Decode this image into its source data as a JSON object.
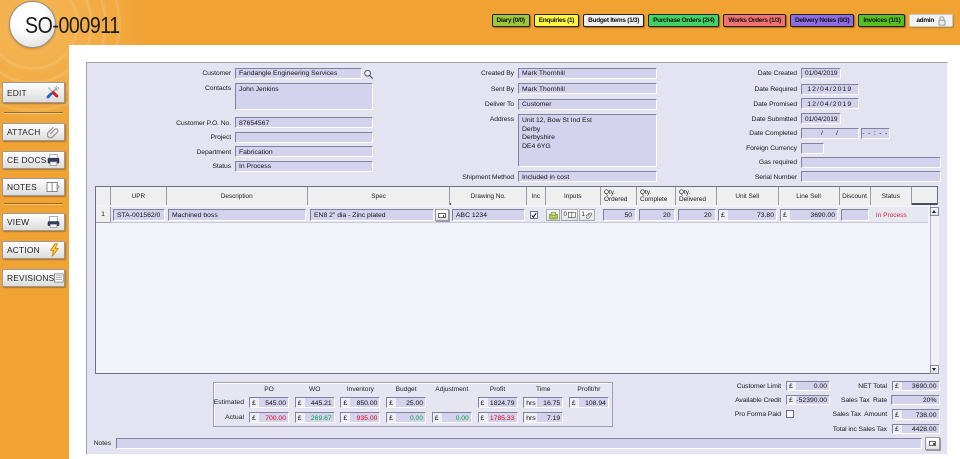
{
  "window": {
    "title": "SO-000911"
  },
  "topbar": {
    "buttons": [
      {
        "label": "Diary (0/0)",
        "color": "#9dc838"
      },
      {
        "label": "Enquiries (1)",
        "color": "#fdf840"
      },
      {
        "label": "Budget Items (1/3)",
        "color": "#efefef"
      },
      {
        "label": "Purchase Orders (2/4)",
        "color": "#3fd463"
      },
      {
        "label": "Works Orders (1/3)",
        "color": "#f27272"
      },
      {
        "label": "Delivery Notes (0/3)",
        "color": "#8d6ce4"
      },
      {
        "label": "Invoices (1/1)",
        "color": "#54c11f"
      },
      {
        "label": "admin",
        "color": "#f4f4f4"
      }
    ]
  },
  "sidebar": {
    "items": [
      {
        "label": "EDIT",
        "icon": "tools-icon"
      },
      {
        "label": "ATTACH",
        "icon": "paperclip-icon"
      },
      {
        "label": "CE DOCS",
        "icon": "printer-icon"
      },
      {
        "label": "NOTES",
        "icon": "book-icon"
      },
      {
        "label": "VIEW",
        "icon": "print-preview-icon"
      },
      {
        "label": "ACTION",
        "icon": "lightning-icon"
      },
      {
        "label": "REVISIONS",
        "icon": "document-icon"
      }
    ]
  },
  "form": {
    "customer": {
      "label": "Customer",
      "value": "Fandangle Engineering Services"
    },
    "contacts": {
      "label": "Contacts",
      "value": "John Jenkins"
    },
    "customer_po": {
      "label": "Customer P.O. No.",
      "value": "87654567"
    },
    "project": {
      "label": "Project",
      "value": ""
    },
    "department": {
      "label": "Department",
      "value": "Fabrication"
    },
    "status": {
      "label": "Status",
      "value": "In Process"
    },
    "created_by": {
      "label": "Created By",
      "value": "Mark Thornhill"
    },
    "sent_by": {
      "label": "Sent By",
      "value": "Mark Thornhill"
    },
    "deliver_to": {
      "label": "Deliver To",
      "value": "Customer"
    },
    "address": {
      "label": "Address",
      "value": "Unit 12, Bow St Ind Est\nDerby\nDerbyshire\nDE4 6YG"
    },
    "shipment_method": {
      "label": "Shipment Method",
      "value": "Included in cost"
    },
    "date_created": {
      "label": "Date Created",
      "value": "01/04/2019"
    },
    "date_required": {
      "label": "Date Required",
      "value": "12/04/2019"
    },
    "date_promised": {
      "label": "Date Promised",
      "value": "12/04/2019"
    },
    "date_submitted": {
      "label": "Date Submitted",
      "value": "01/04/2019"
    },
    "date_completed": {
      "label": "Date Completed",
      "value": "/    /",
      "time": "- - : - -"
    },
    "foreign_currency": {
      "label": "Foreign Currency",
      "value": ""
    },
    "gas_required": {
      "label": "Gas required",
      "value": ""
    },
    "serial_number": {
      "label": "Serial Number",
      "value": ""
    }
  },
  "table": {
    "columns": {
      "upr": "UPR",
      "description": "Description",
      "spec": "Spec",
      "drawing": "Drawing No.",
      "inc": "Inc",
      "inputs": "Inputs",
      "qty_ordered": "Qty.\nOrdered",
      "qty_complete": "Qty.\nComplete",
      "qty_delivered": "Qty.\nDelivered",
      "unit_sell": "Unit Sell",
      "line_sell": "Line Sell",
      "discount": "Discount",
      "status": "Status"
    },
    "rows": [
      {
        "num": "1",
        "upr": "STA-001562/0",
        "description": "Machined boss",
        "spec": "EN8 2\" dia - Zinc plated",
        "drawing": "ABC 1234",
        "inc": true,
        "inputs_docs": "0",
        "inputs_attach": "1",
        "qty_ordered": "50",
        "qty_complete": "20",
        "qty_delivered": "20",
        "unit_sell": "73.80",
        "line_sell": "3690.00",
        "discount": "",
        "status": "In Process"
      }
    ]
  },
  "summary": {
    "currency": "£",
    "hours_prefix": "hrs",
    "columns": [
      "PO",
      "WO",
      "Inventory",
      "Budget",
      "Adjustment",
      "Profit",
      "Time",
      "Profit/hr"
    ],
    "estimated": {
      "label": "Estimated",
      "po": "545.00",
      "wo": "445.21",
      "inventory": "850.00",
      "budget": "25.00",
      "profit": "1824.79",
      "time": "16.75",
      "profit_hr": "108.94"
    },
    "actual": {
      "label": "Actual",
      "po": "700.00",
      "wo": "269.67",
      "inventory": "935.00",
      "budget": "0.00",
      "adjustment": "0.00",
      "profit": "1785.33",
      "time": "7.19"
    }
  },
  "totals": {
    "customer_limit": {
      "label": "Customer Limit",
      "value": "0.00"
    },
    "available_credit": {
      "label": "Available Credit",
      "value": "-52390.00"
    },
    "pro_forma_paid": {
      "label": "Pro Forma Paid"
    },
    "net_total": {
      "label": "NET Total",
      "value": "3690.00"
    },
    "sales_tax_rate": {
      "label": "Sales Tax  Rate",
      "value": "20%"
    },
    "sales_tax_amount": {
      "label": "Sales Tax  Amount",
      "value": "738.00"
    },
    "total_inc_tax": {
      "label": "Total inc Sales Tax",
      "value": "4428.00"
    }
  },
  "notes": {
    "label": "Notes",
    "value": ""
  }
}
